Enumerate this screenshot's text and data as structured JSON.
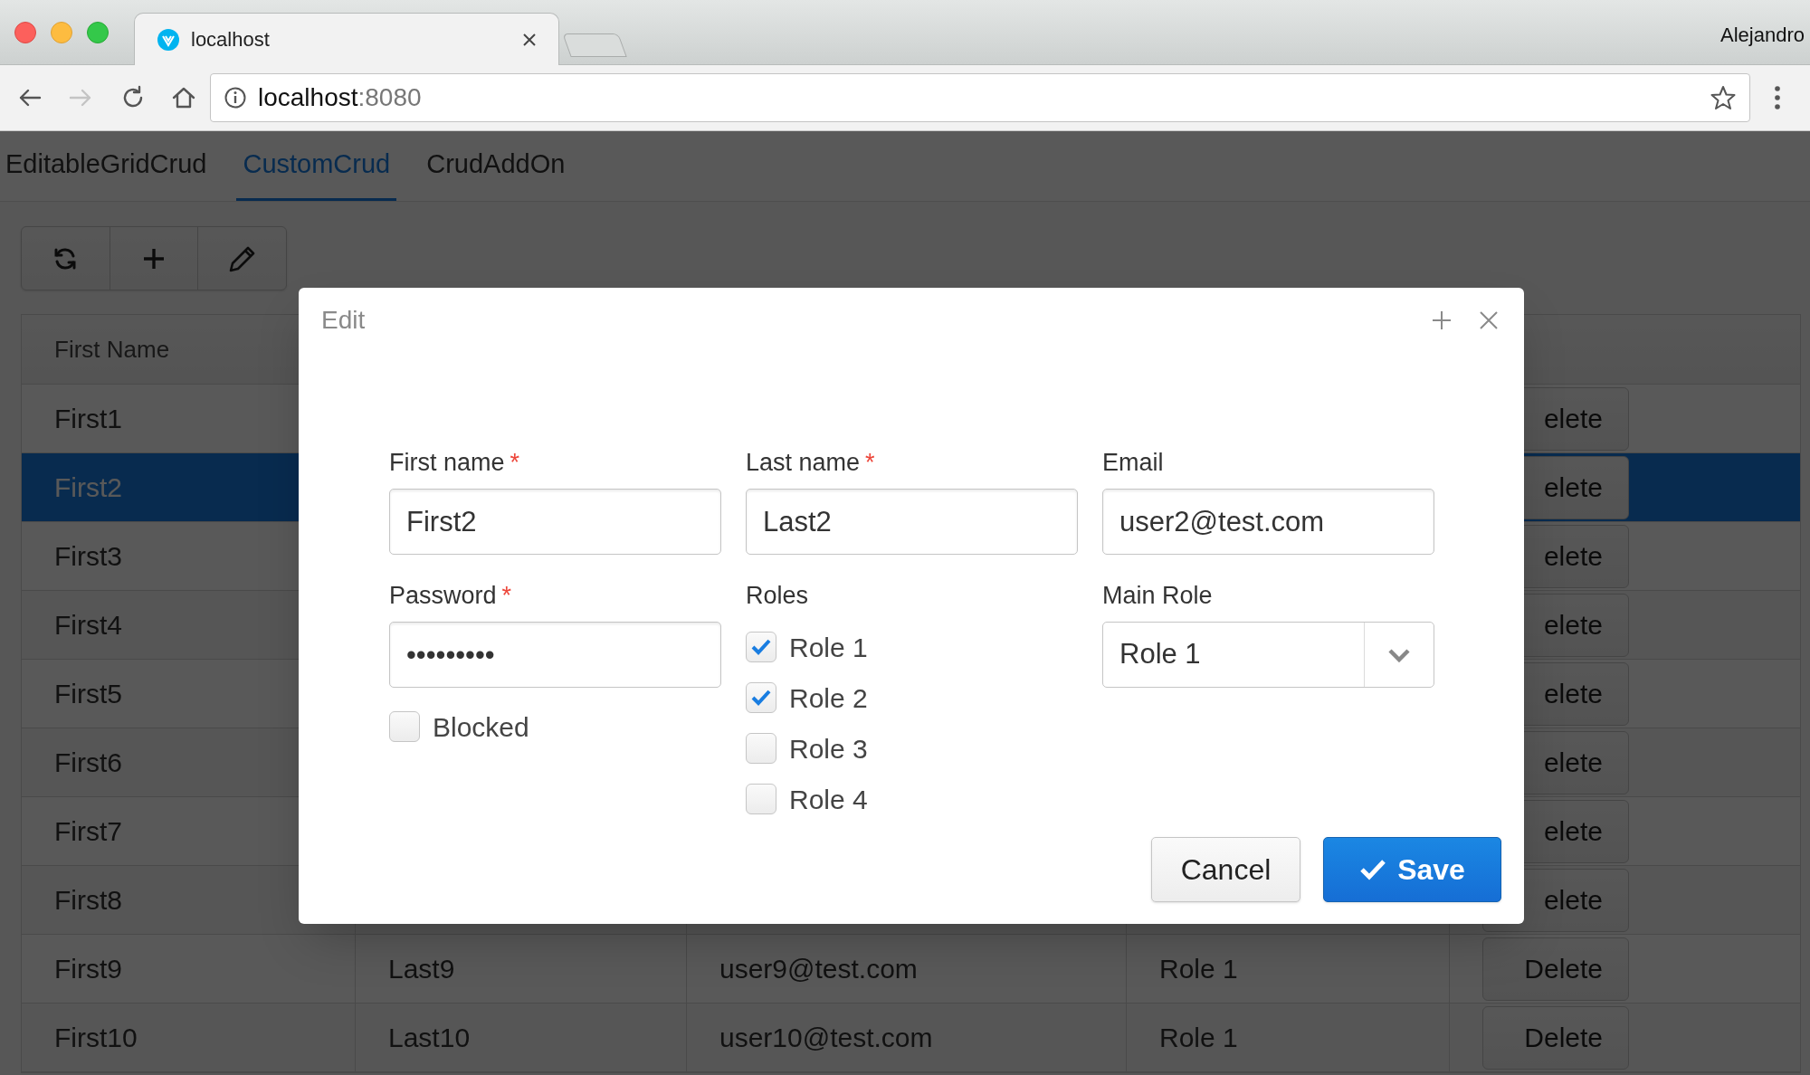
{
  "browser": {
    "tab_title": "localhost",
    "address_host": "localhost",
    "address_port": ":8080",
    "profile_name": "Alejandro"
  },
  "app_tabs": [
    {
      "label": "EditableGridCrud",
      "selected": false
    },
    {
      "label": "CustomCrud",
      "selected": true
    },
    {
      "label": "CrudAddOn",
      "selected": false
    }
  ],
  "grid": {
    "columns": [
      "First Name"
    ],
    "rows": [
      {
        "first_name": "First1",
        "selected": false,
        "delete": "elete"
      },
      {
        "first_name": "First2",
        "selected": true,
        "delete": "elete"
      },
      {
        "first_name": "First3",
        "selected": false,
        "delete": "elete"
      },
      {
        "first_name": "First4",
        "selected": false,
        "delete": "elete"
      },
      {
        "first_name": "First5",
        "selected": false,
        "delete": "elete"
      },
      {
        "first_name": "First6",
        "selected": false,
        "delete": "elete"
      },
      {
        "first_name": "First7",
        "selected": false,
        "delete": "elete"
      },
      {
        "first_name": "First8",
        "selected": false,
        "delete": "elete"
      },
      {
        "first_name": "First9",
        "last_name": "Last9",
        "email": "user9@test.com",
        "main_role": "Role 1",
        "selected": false,
        "delete": "Delete"
      },
      {
        "first_name": "First10",
        "last_name": "Last10",
        "email": "user10@test.com",
        "main_role": "Role 1",
        "selected": false,
        "delete": "Delete"
      }
    ]
  },
  "dialog": {
    "title": "Edit",
    "fields": [
      {
        "label": "First name",
        "required_mark": "*",
        "value": "First2"
      },
      {
        "label": "Last name",
        "required_mark": "*",
        "value": "Last2"
      },
      {
        "label": "Email",
        "value": "user2@test.com"
      }
    ],
    "password": {
      "label": "Password",
      "required_mark": "*",
      "value": "•••••••••"
    },
    "blocked": {
      "label": "Blocked",
      "checked": false
    },
    "roles": {
      "label": "Roles",
      "options": [
        {
          "label": "Role 1",
          "checked": true
        },
        {
          "label": "Role 2",
          "checked": true
        },
        {
          "label": "Role 3",
          "checked": false
        },
        {
          "label": "Role 4",
          "checked": false
        }
      ]
    },
    "main_role": {
      "label": "Main Role",
      "value": "Role 1"
    },
    "buttons": [
      {
        "label": "Cancel",
        "kind": "secondary"
      },
      {
        "label": "Save",
        "kind": "primary"
      }
    ]
  }
}
